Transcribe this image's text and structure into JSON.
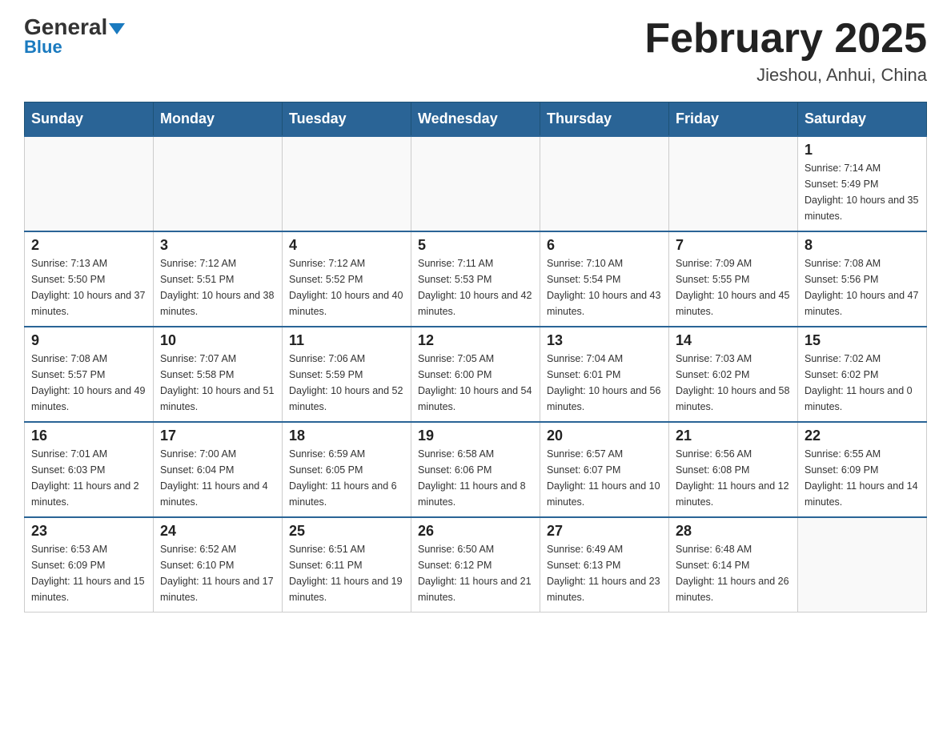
{
  "header": {
    "logo_general": "General",
    "logo_blue": "Blue",
    "month_title": "February 2025",
    "location": "Jieshou, Anhui, China"
  },
  "days_of_week": [
    "Sunday",
    "Monday",
    "Tuesday",
    "Wednesday",
    "Thursday",
    "Friday",
    "Saturday"
  ],
  "weeks": [
    [
      {
        "day": "",
        "sunrise": "",
        "sunset": "",
        "daylight": ""
      },
      {
        "day": "",
        "sunrise": "",
        "sunset": "",
        "daylight": ""
      },
      {
        "day": "",
        "sunrise": "",
        "sunset": "",
        "daylight": ""
      },
      {
        "day": "",
        "sunrise": "",
        "sunset": "",
        "daylight": ""
      },
      {
        "day": "",
        "sunrise": "",
        "sunset": "",
        "daylight": ""
      },
      {
        "day": "",
        "sunrise": "",
        "sunset": "",
        "daylight": ""
      },
      {
        "day": "1",
        "sunrise": "Sunrise: 7:14 AM",
        "sunset": "Sunset: 5:49 PM",
        "daylight": "Daylight: 10 hours and 35 minutes."
      }
    ],
    [
      {
        "day": "2",
        "sunrise": "Sunrise: 7:13 AM",
        "sunset": "Sunset: 5:50 PM",
        "daylight": "Daylight: 10 hours and 37 minutes."
      },
      {
        "day": "3",
        "sunrise": "Sunrise: 7:12 AM",
        "sunset": "Sunset: 5:51 PM",
        "daylight": "Daylight: 10 hours and 38 minutes."
      },
      {
        "day": "4",
        "sunrise": "Sunrise: 7:12 AM",
        "sunset": "Sunset: 5:52 PM",
        "daylight": "Daylight: 10 hours and 40 minutes."
      },
      {
        "day": "5",
        "sunrise": "Sunrise: 7:11 AM",
        "sunset": "Sunset: 5:53 PM",
        "daylight": "Daylight: 10 hours and 42 minutes."
      },
      {
        "day": "6",
        "sunrise": "Sunrise: 7:10 AM",
        "sunset": "Sunset: 5:54 PM",
        "daylight": "Daylight: 10 hours and 43 minutes."
      },
      {
        "day": "7",
        "sunrise": "Sunrise: 7:09 AM",
        "sunset": "Sunset: 5:55 PM",
        "daylight": "Daylight: 10 hours and 45 minutes."
      },
      {
        "day": "8",
        "sunrise": "Sunrise: 7:08 AM",
        "sunset": "Sunset: 5:56 PM",
        "daylight": "Daylight: 10 hours and 47 minutes."
      }
    ],
    [
      {
        "day": "9",
        "sunrise": "Sunrise: 7:08 AM",
        "sunset": "Sunset: 5:57 PM",
        "daylight": "Daylight: 10 hours and 49 minutes."
      },
      {
        "day": "10",
        "sunrise": "Sunrise: 7:07 AM",
        "sunset": "Sunset: 5:58 PM",
        "daylight": "Daylight: 10 hours and 51 minutes."
      },
      {
        "day": "11",
        "sunrise": "Sunrise: 7:06 AM",
        "sunset": "Sunset: 5:59 PM",
        "daylight": "Daylight: 10 hours and 52 minutes."
      },
      {
        "day": "12",
        "sunrise": "Sunrise: 7:05 AM",
        "sunset": "Sunset: 6:00 PM",
        "daylight": "Daylight: 10 hours and 54 minutes."
      },
      {
        "day": "13",
        "sunrise": "Sunrise: 7:04 AM",
        "sunset": "Sunset: 6:01 PM",
        "daylight": "Daylight: 10 hours and 56 minutes."
      },
      {
        "day": "14",
        "sunrise": "Sunrise: 7:03 AM",
        "sunset": "Sunset: 6:02 PM",
        "daylight": "Daylight: 10 hours and 58 minutes."
      },
      {
        "day": "15",
        "sunrise": "Sunrise: 7:02 AM",
        "sunset": "Sunset: 6:02 PM",
        "daylight": "Daylight: 11 hours and 0 minutes."
      }
    ],
    [
      {
        "day": "16",
        "sunrise": "Sunrise: 7:01 AM",
        "sunset": "Sunset: 6:03 PM",
        "daylight": "Daylight: 11 hours and 2 minutes."
      },
      {
        "day": "17",
        "sunrise": "Sunrise: 7:00 AM",
        "sunset": "Sunset: 6:04 PM",
        "daylight": "Daylight: 11 hours and 4 minutes."
      },
      {
        "day": "18",
        "sunrise": "Sunrise: 6:59 AM",
        "sunset": "Sunset: 6:05 PM",
        "daylight": "Daylight: 11 hours and 6 minutes."
      },
      {
        "day": "19",
        "sunrise": "Sunrise: 6:58 AM",
        "sunset": "Sunset: 6:06 PM",
        "daylight": "Daylight: 11 hours and 8 minutes."
      },
      {
        "day": "20",
        "sunrise": "Sunrise: 6:57 AM",
        "sunset": "Sunset: 6:07 PM",
        "daylight": "Daylight: 11 hours and 10 minutes."
      },
      {
        "day": "21",
        "sunrise": "Sunrise: 6:56 AM",
        "sunset": "Sunset: 6:08 PM",
        "daylight": "Daylight: 11 hours and 12 minutes."
      },
      {
        "day": "22",
        "sunrise": "Sunrise: 6:55 AM",
        "sunset": "Sunset: 6:09 PM",
        "daylight": "Daylight: 11 hours and 14 minutes."
      }
    ],
    [
      {
        "day": "23",
        "sunrise": "Sunrise: 6:53 AM",
        "sunset": "Sunset: 6:09 PM",
        "daylight": "Daylight: 11 hours and 15 minutes."
      },
      {
        "day": "24",
        "sunrise": "Sunrise: 6:52 AM",
        "sunset": "Sunset: 6:10 PM",
        "daylight": "Daylight: 11 hours and 17 minutes."
      },
      {
        "day": "25",
        "sunrise": "Sunrise: 6:51 AM",
        "sunset": "Sunset: 6:11 PM",
        "daylight": "Daylight: 11 hours and 19 minutes."
      },
      {
        "day": "26",
        "sunrise": "Sunrise: 6:50 AM",
        "sunset": "Sunset: 6:12 PM",
        "daylight": "Daylight: 11 hours and 21 minutes."
      },
      {
        "day": "27",
        "sunrise": "Sunrise: 6:49 AM",
        "sunset": "Sunset: 6:13 PM",
        "daylight": "Daylight: 11 hours and 23 minutes."
      },
      {
        "day": "28",
        "sunrise": "Sunrise: 6:48 AM",
        "sunset": "Sunset: 6:14 PM",
        "daylight": "Daylight: 11 hours and 26 minutes."
      },
      {
        "day": "",
        "sunrise": "",
        "sunset": "",
        "daylight": ""
      }
    ]
  ]
}
